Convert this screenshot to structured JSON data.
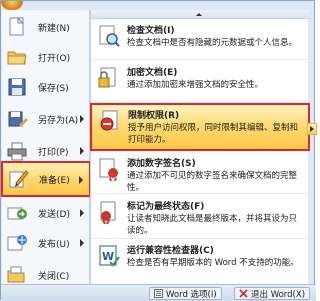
{
  "left_menu": [
    {
      "label": "新建(N)",
      "icon": "new-document-icon",
      "submenu": false
    },
    {
      "label": "打开(O)",
      "icon": "open-folder-icon",
      "submenu": false
    },
    {
      "label": "保存(S)",
      "icon": "save-icon",
      "submenu": false
    },
    {
      "label": "另存为(A)",
      "icon": "save-as-icon",
      "submenu": true
    },
    {
      "label": "打印(P)",
      "icon": "print-icon",
      "submenu": true
    },
    {
      "label": "准备(E)",
      "icon": "prepare-icon",
      "submenu": true,
      "active": true
    },
    {
      "label": "发送(D)",
      "icon": "send-icon",
      "submenu": true
    },
    {
      "label": "发布(U)",
      "icon": "publish-icon",
      "submenu": true
    },
    {
      "label": "关闭(C)",
      "icon": "close-document-icon",
      "submenu": false
    }
  ],
  "sub_menu": [
    {
      "title": "检查文档(I)",
      "desc": "检查文档中是否有隐藏的元数据或个人信息。",
      "icon": "inspect-document-icon"
    },
    {
      "title": "加密文档(E)",
      "desc": "通过添加加密来增强文档的安全性。",
      "icon": "encrypt-document-icon"
    },
    {
      "title": "限制权限(R)",
      "desc": "授予用户访问权限，同时限制其编辑、复制和打印能力。",
      "icon": "restrict-permission-icon",
      "active": true
    },
    {
      "title": "添加数字签名(S)",
      "desc": "通过添加不可见的数字签名来确保文档的完整性。",
      "icon": "digital-signature-icon"
    },
    {
      "title": "标记为最终状态(F)",
      "desc": "让读者知晓此文档是最终版本，并将其设为只读的。",
      "icon": "mark-final-icon"
    },
    {
      "title": "运行兼容性检查器(C)",
      "desc": "检查是否有早期版本的 Word 不支持的功能。",
      "icon": "compatibility-checker-icon"
    }
  ],
  "footer": {
    "options_label": "Word 选项(I)",
    "exit_label": "退出 Word(X)"
  },
  "colors": {
    "accent": "#ffc84b",
    "highlight": "#e0262a"
  }
}
